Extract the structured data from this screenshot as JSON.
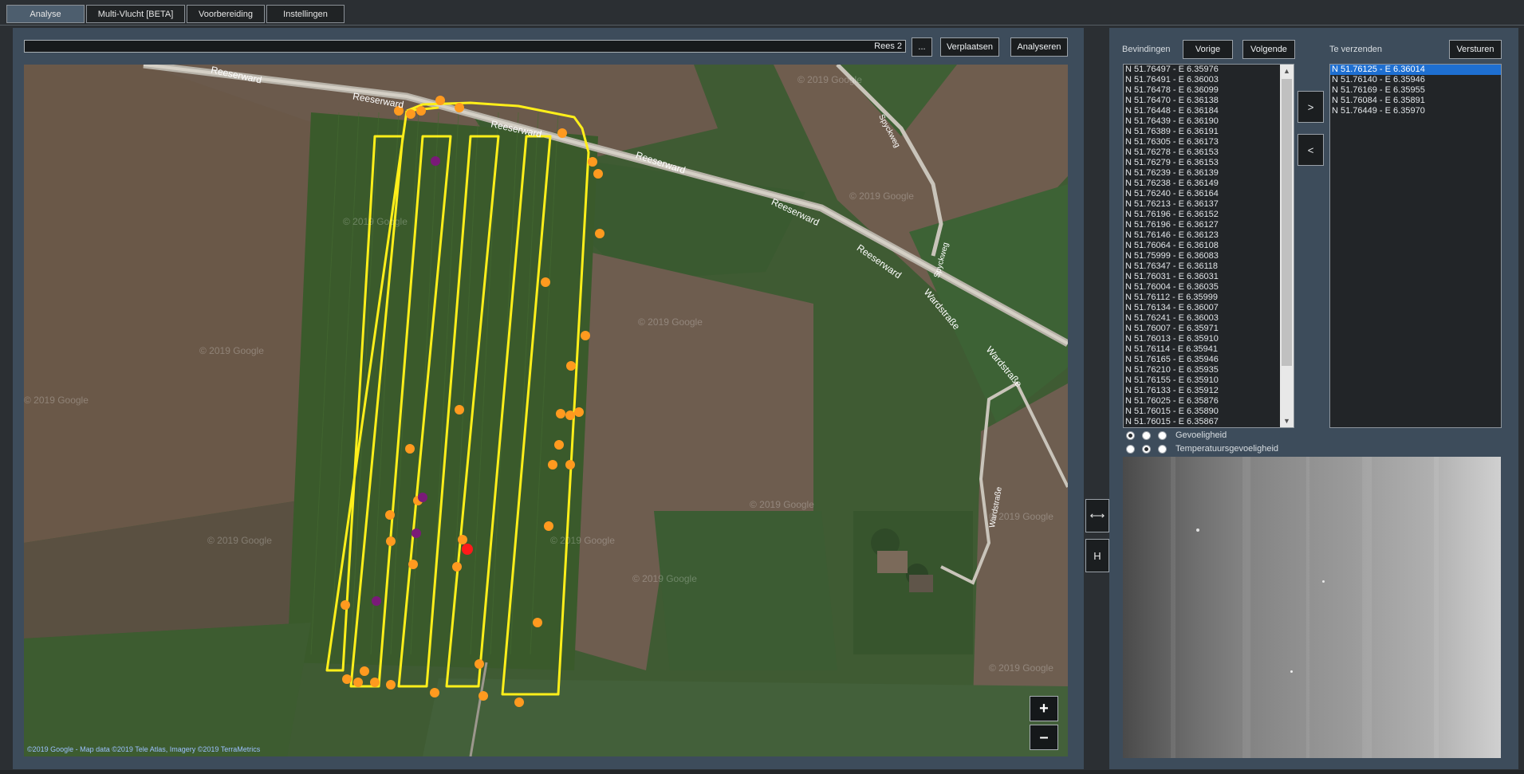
{
  "tabs": [
    "Analyse",
    "Multi-Vlucht [BETA]",
    "Voorbereiding",
    "Instellingen"
  ],
  "toolbar": {
    "path_value": "Rees 2",
    "browse_label": "...",
    "move_label": "Verplaatsen",
    "analyze_label": "Analyseren"
  },
  "map": {
    "roads": [
      "Reeserward",
      "Reeserward",
      "Reeserward",
      "Reeserward",
      "Reeserward",
      "Reeserward",
      "Spyckweg",
      "Spyckweg",
      "Wardstraße",
      "Wardstraße",
      "Wardstraße"
    ],
    "watermark": "© 2019 Google",
    "attribution": "©2019 Google - Map data ©2019 Tele Atlas, Imagery ©2019 TerraMetrics",
    "zoom_in": "+",
    "zoom_out": "–"
  },
  "side_buttons": {
    "swap": "⟷",
    "h": "H"
  },
  "findings": {
    "label": "Bevindingen",
    "prev_label": "Vorige",
    "next_label": "Volgende",
    "items": [
      "N 51.76497 - E 6.35976",
      "N 51.76491 - E 6.36003",
      "N 51.76478 - E 6.36099",
      "N 51.76470 - E 6.36138",
      "N 51.76448 - E 6.36184",
      "N 51.76439 - E 6.36190",
      "N 51.76389 - E 6.36191",
      "N 51.76305 - E 6.36173",
      "N 51.76278 - E 6.36153",
      "N 51.76279 - E 6.36153",
      "N 51.76239 - E 6.36139",
      "N 51.76238 - E 6.36149",
      "N 51.76240 - E 6.36164",
      "N 51.76213 - E 6.36137",
      "N 51.76196 - E 6.36152",
      "N 51.76196 - E 6.36127",
      "N 51.76146 - E 6.36123",
      "N 51.76064 - E 6.36108",
      "N 51.75999 - E 6.36083",
      "N 51.76347 - E 6.36118",
      "N 51.76031 - E 6.36031",
      "N 51.76004 - E 6.36035",
      "N 51.76112 - E 6.35999",
      "N 51.76134 - E 6.36007",
      "N 51.76241 - E 6.36003",
      "N 51.76007 - E 6.35971",
      "N 51.76013 - E 6.35910",
      "N 51.76114 - E 6.35941",
      "N 51.76165 - E 6.35946",
      "N 51.76210 - E 6.35935",
      "N 51.76155 - E 6.35910",
      "N 51.76133 - E 6.35912",
      "N 51.76025 - E 6.35876",
      "N 51.76015 - E 6.35890",
      "N 51.76015 - E 6.35867"
    ]
  },
  "transfer": {
    "add": ">",
    "remove": "<"
  },
  "to_send": {
    "label": "Te verzenden",
    "send_label": "Versturen",
    "items": [
      "N 51.76125 - E 6.36014",
      "N 51.76140 - E 6.35946",
      "N 51.76169 - E 6.35955",
      "N 51.76084 - E 6.35891",
      "N 51.76449 - E 6.35970"
    ]
  },
  "options": {
    "sensitivity_label": "Gevoeligheid",
    "temp_sensitivity_label": "Temperatuursgevoeligheid"
  }
}
